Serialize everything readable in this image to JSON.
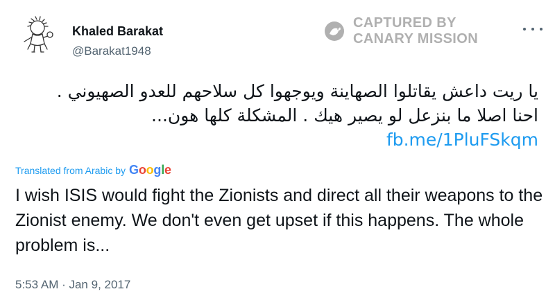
{
  "tweet": {
    "author_name": "Khaled Barakat",
    "author_handle": "@Barakat1948",
    "arabic_text": "يا ريت داعش يقاتلوا الصهاينة ويوجهوا كل سلاحهم للعدو الصهيوني . احنا اصلا ما بنزعل لو يصير هيك . المشكلة كلها هون...",
    "link_text": "fb.me/1PluFSkqm",
    "translated_label": "Translated from Arabic by",
    "google_letters": [
      "G",
      "o",
      "o",
      "g",
      "l",
      "e"
    ],
    "translation": "I wish ISIS would fight the Zionists and direct all their weapons to the Zionist enemy. We don't even get upset if this happens. The whole problem is...",
    "timestamp": "5:53 AM · Jan 9, 2017"
  },
  "watermark": {
    "line1": "CAPTURED BY",
    "line2": "CANARY MISSION",
    "color": "#b0b0b0"
  },
  "icons": {
    "avatar": "handala-cartoon-avatar",
    "watermark": "canary-bird-logo-icon",
    "more": "more-options-icon"
  },
  "colors": {
    "link": "#1d9bf0",
    "text": "#0f1419",
    "secondary": "#536471",
    "google": [
      "#4285f4",
      "#ea4335",
      "#fbbc05",
      "#4285f4",
      "#34a853",
      "#ea4335"
    ]
  }
}
